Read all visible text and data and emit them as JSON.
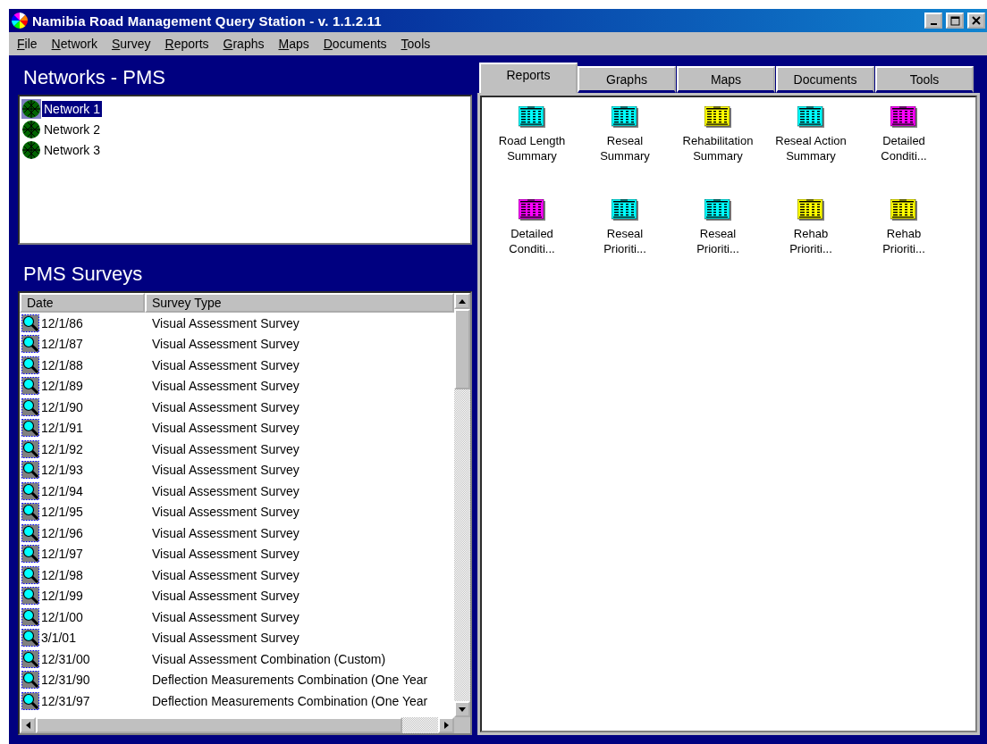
{
  "window": {
    "title": "Namibia Road Management Query Station - v. 1.1.2.11"
  },
  "menu": [
    "File",
    "Network",
    "Survey",
    "Reports",
    "Graphs",
    "Maps",
    "Documents",
    "Tools"
  ],
  "networks_panel": {
    "title": "Networks - PMS",
    "items": [
      {
        "label": "Network 1",
        "selected": true
      },
      {
        "label": "Network 2",
        "selected": false
      },
      {
        "label": "Network 3",
        "selected": false
      }
    ]
  },
  "surveys_panel": {
    "title": "PMS Surveys",
    "columns": [
      "Date",
      "Survey Type"
    ],
    "rows": [
      {
        "date": "12/1/86",
        "type": "Visual Assessment Survey"
      },
      {
        "date": "12/1/87",
        "type": "Visual Assessment Survey"
      },
      {
        "date": "12/1/88",
        "type": "Visual Assessment Survey"
      },
      {
        "date": "12/1/89",
        "type": "Visual Assessment Survey"
      },
      {
        "date": "12/1/90",
        "type": "Visual Assessment Survey"
      },
      {
        "date": "12/1/91",
        "type": "Visual Assessment Survey"
      },
      {
        "date": "12/1/92",
        "type": "Visual Assessment Survey"
      },
      {
        "date": "12/1/93",
        "type": "Visual Assessment Survey"
      },
      {
        "date": "12/1/94",
        "type": "Visual Assessment Survey"
      },
      {
        "date": "12/1/95",
        "type": "Visual Assessment Survey"
      },
      {
        "date": "12/1/96",
        "type": "Visual Assessment Survey"
      },
      {
        "date": "12/1/97",
        "type": "Visual Assessment Survey"
      },
      {
        "date": "12/1/98",
        "type": "Visual Assessment Survey"
      },
      {
        "date": "12/1/99",
        "type": "Visual Assessment Survey"
      },
      {
        "date": "12/1/00",
        "type": "Visual Assessment Survey"
      },
      {
        "date": "3/1/01",
        "type": "Visual Assessment Survey"
      },
      {
        "date": "12/31/00",
        "type": "Visual Assessment Combination (Custom)"
      },
      {
        "date": "12/31/90",
        "type": "Deflection Measurements Combination (One Year"
      },
      {
        "date": "12/31/97",
        "type": "Deflection Measurements Combination (One Year"
      }
    ]
  },
  "tabs": [
    {
      "label": "Reports",
      "selected": true
    },
    {
      "label": "Graphs",
      "selected": false
    },
    {
      "label": "Maps",
      "selected": false
    },
    {
      "label": "Documents",
      "selected": false
    },
    {
      "label": "Tools",
      "selected": false
    }
  ],
  "reports": [
    {
      "label": "Road Length Summary",
      "color": "#00ffff"
    },
    {
      "label": "Reseal Summary",
      "color": "#00ffff"
    },
    {
      "label": "Rehabilitation Summary",
      "color": "#ffff00"
    },
    {
      "label": "Reseal Action Summary",
      "color": "#00ffff"
    },
    {
      "label": "Detailed Conditi...",
      "color": "#ff00ff"
    },
    {
      "label": "Detailed Conditi...",
      "color": "#ff00ff"
    },
    {
      "label": "Reseal Prioriti...",
      "color": "#00ffff"
    },
    {
      "label": "Reseal Prioriti...",
      "color": "#00ffff"
    },
    {
      "label": "Rehab Prioriti...",
      "color": "#ffff00"
    },
    {
      "label": "Rehab Prioriti...",
      "color": "#ffff00"
    }
  ]
}
